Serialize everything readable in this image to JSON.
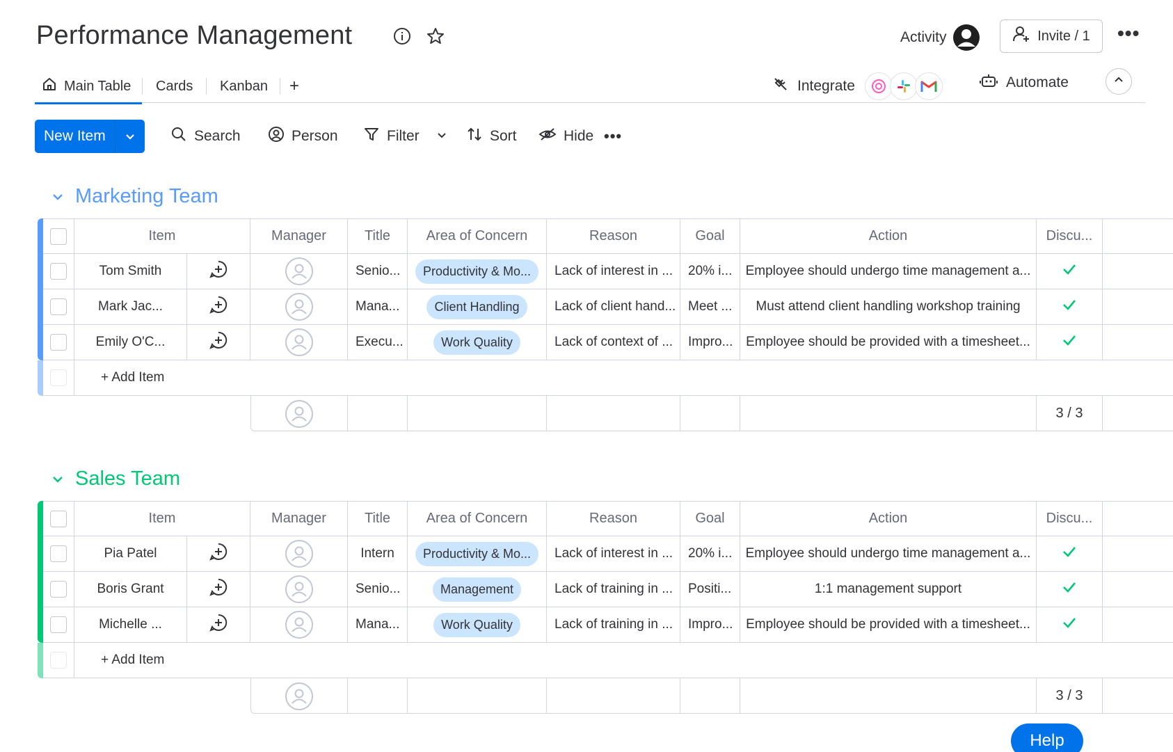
{
  "header": {
    "title": "Performance Management",
    "activity_label": "Activity",
    "invite_label": "Invite / 1"
  },
  "views": {
    "tabs": [
      {
        "label": "Main Table",
        "active": true
      },
      {
        "label": "Cards"
      },
      {
        "label": "Kanban"
      }
    ],
    "add_label": "+",
    "integrate_label": "Integrate",
    "automate_label": "Automate"
  },
  "toolbar": {
    "new_item_label": "New Item",
    "search_label": "Search",
    "person_label": "Person",
    "filter_label": "Filter",
    "sort_label": "Sort",
    "hide_label": "Hide"
  },
  "columns": [
    "Item",
    "Manager",
    "Title",
    "Area of Concern",
    "Reason",
    "Goal",
    "Action",
    "Discu..."
  ],
  "groups": [
    {
      "title": "Marketing Team",
      "color": "#579bfc",
      "rows": [
        {
          "item": "Tom Smith",
          "title": "Senio...",
          "area": "Productivity & Mo...",
          "reason": "Lack of interest in ...",
          "goal": "20% i...",
          "action": "Employee should undergo time management a..."
        },
        {
          "item": "Mark Jac...",
          "title": "Mana...",
          "area": "Client Handling",
          "reason": "Lack of client hand...",
          "goal": "Meet ...",
          "action": "Must attend client handling workshop training"
        },
        {
          "item": "Emily O'C...",
          "title": "Execu...",
          "area": "Work Quality",
          "reason": "Lack of context of ...",
          "goal": "Impro...",
          "action": "Employee should be provided with a timesheet..."
        }
      ],
      "add_item_label": "+ Add Item",
      "summary": "3 / 3"
    },
    {
      "title": "Sales Team",
      "color": "#00c875",
      "rows": [
        {
          "item": "Pia Patel",
          "title": "Intern",
          "area": "Productivity & Mo...",
          "reason": "Lack of interest in ...",
          "goal": "20% i...",
          "action": "Employee should undergo time management a..."
        },
        {
          "item": "Boris Grant",
          "title": "Senio...",
          "area": "Management",
          "reason": "Lack of training in ...",
          "goal": "Positi...",
          "action": "1:1 management support"
        },
        {
          "item": "Michelle ...",
          "title": "Mana...",
          "area": "Work Quality",
          "reason": "Lack of training in ...",
          "goal": "Impro...",
          "action": "Employee should be provided with a timesheet..."
        }
      ],
      "add_item_label": "+ Add Item",
      "summary": "3 / 3"
    }
  ],
  "help_label": "Help",
  "colors": {
    "primary": "#0073ea",
    "pill": "#cce5ff",
    "check": "#00c875",
    "border": "#d0d4e4"
  }
}
